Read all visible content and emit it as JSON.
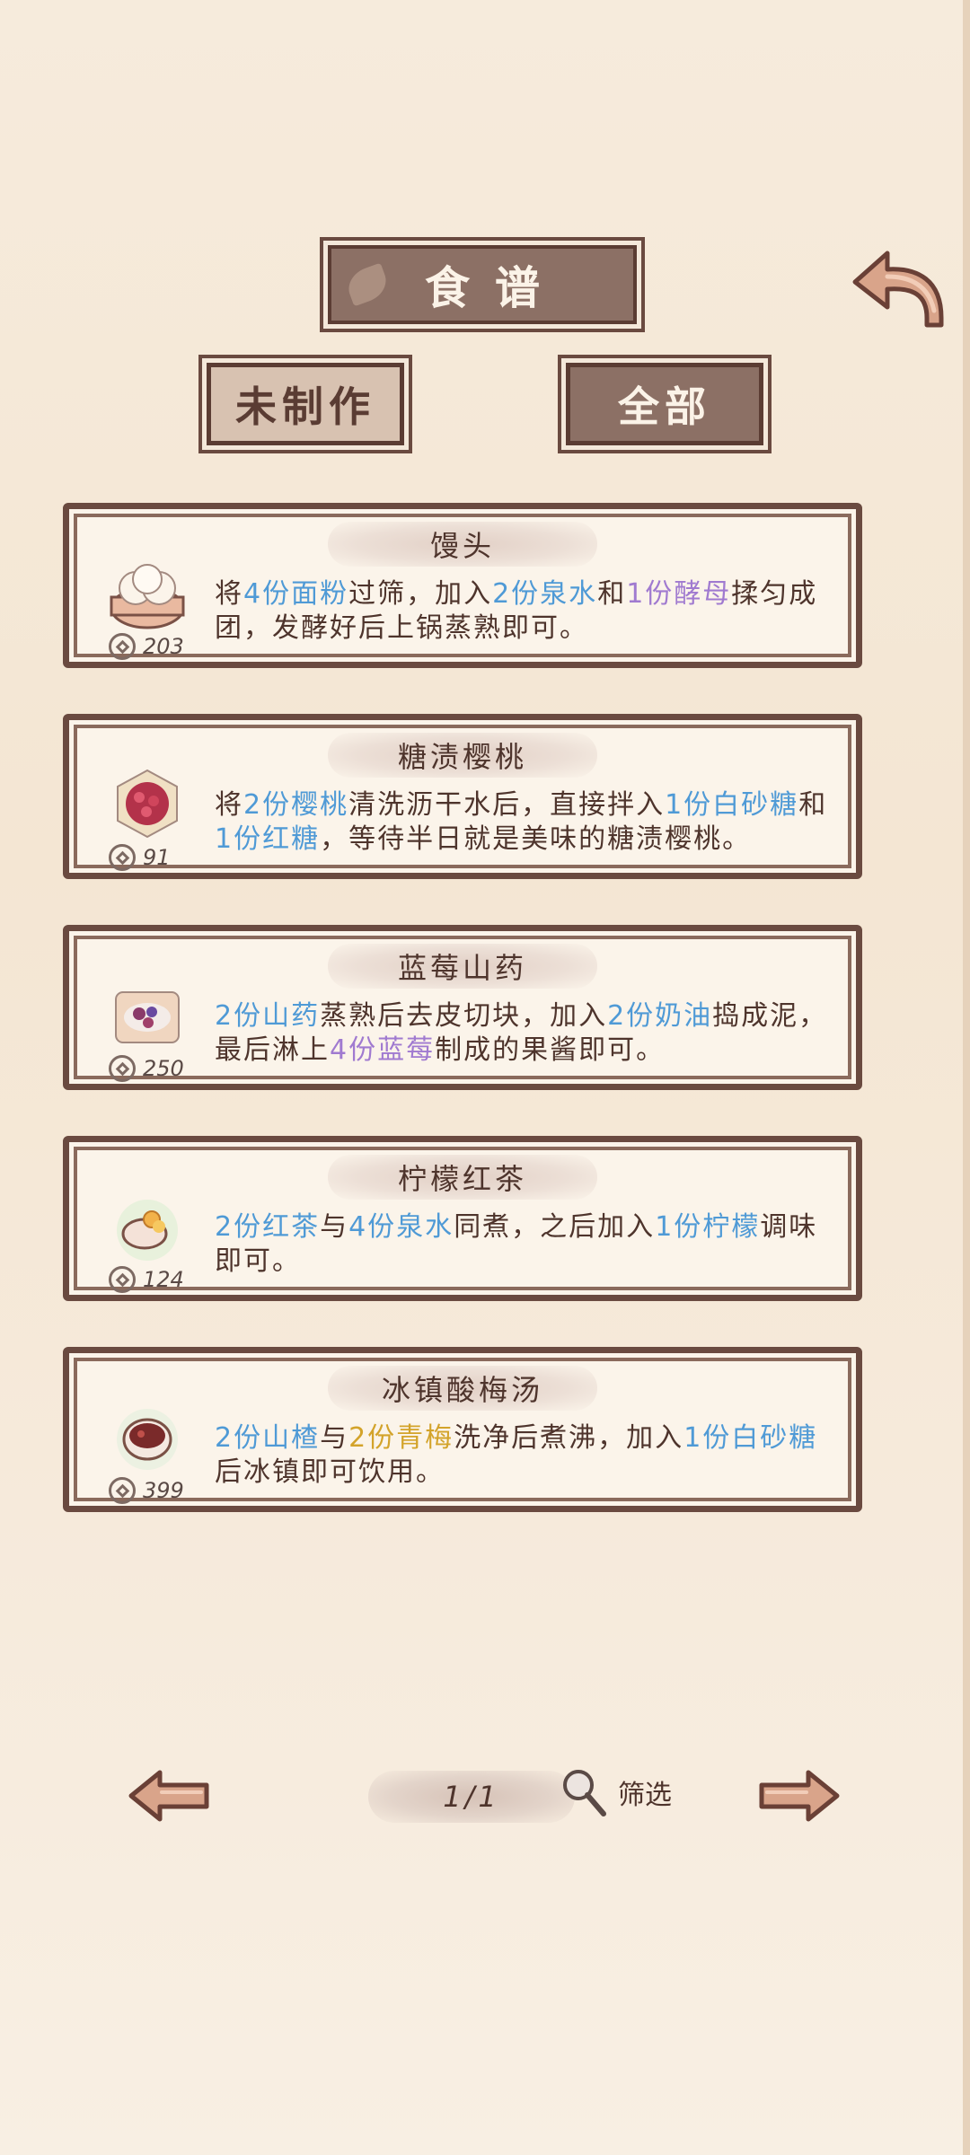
{
  "header": {
    "title": "食谱",
    "tab_inactive": "未制作",
    "tab_active": "全部"
  },
  "recipes": [
    {
      "name": "馒头",
      "price": "203",
      "desc": [
        {
          "t": "将",
          "c": ""
        },
        {
          "t": "4份面粉",
          "c": "blue"
        },
        {
          "t": "过筛，加入",
          "c": ""
        },
        {
          "t": "2份泉水",
          "c": "blue"
        },
        {
          "t": "和",
          "c": ""
        },
        {
          "t": "1份酵母",
          "c": "purple"
        },
        {
          "t": "揉匀成团，发酵好后上锅蒸熟即可。",
          "c": ""
        }
      ]
    },
    {
      "name": "糖渍樱桃",
      "price": "91",
      "desc": [
        {
          "t": "将",
          "c": ""
        },
        {
          "t": "2份樱桃",
          "c": "blue"
        },
        {
          "t": "清洗沥干水后，直接拌入",
          "c": ""
        },
        {
          "t": "1份白砂糖",
          "c": "blue"
        },
        {
          "t": "和",
          "c": ""
        },
        {
          "t": "1份红糖",
          "c": "blue"
        },
        {
          "t": "，等待半日就是美味的糖渍樱桃。",
          "c": ""
        }
      ]
    },
    {
      "name": "蓝莓山药",
      "price": "250",
      "desc": [
        {
          "t": "2份山药",
          "c": "blue"
        },
        {
          "t": "蒸熟后去皮切块，加入",
          "c": ""
        },
        {
          "t": "2份奶油",
          "c": "blue"
        },
        {
          "t": "捣成泥，最后淋上",
          "c": ""
        },
        {
          "t": "4份蓝莓",
          "c": "purple"
        },
        {
          "t": "制成的果酱即可。",
          "c": ""
        }
      ]
    },
    {
      "name": "柠檬红茶",
      "price": "124",
      "desc": [
        {
          "t": "2份红茶",
          "c": "blue"
        },
        {
          "t": "与",
          "c": ""
        },
        {
          "t": "4份泉水",
          "c": "blue"
        },
        {
          "t": "同煮，之后加入",
          "c": ""
        },
        {
          "t": "1份柠檬",
          "c": "blue"
        },
        {
          "t": "调味即可。",
          "c": ""
        }
      ]
    },
    {
      "name": "冰镇酸梅汤",
      "price": "399",
      "desc": [
        {
          "t": "2份山楂",
          "c": "blue"
        },
        {
          "t": "与",
          "c": ""
        },
        {
          "t": "2份青梅",
          "c": "yellow"
        },
        {
          "t": "洗净后煮沸，加入",
          "c": ""
        },
        {
          "t": "1份白砂糖",
          "c": "blue"
        },
        {
          "t": "后冰镇即可饮用。",
          "c": ""
        }
      ]
    }
  ],
  "footer": {
    "page": "1/1",
    "filter_label": "筛选"
  },
  "icons": {
    "back": "back-arrow-icon",
    "prev": "left-arrow-icon",
    "next": "right-arrow-icon",
    "filter": "magnifier-icon",
    "coin": "coin-icon"
  },
  "colors": {
    "highlight_blue": "#4f9ad6",
    "highlight_purple": "#a07ad0",
    "highlight_yellow": "#d3a32a",
    "frame_brown": "#6a4a40"
  }
}
